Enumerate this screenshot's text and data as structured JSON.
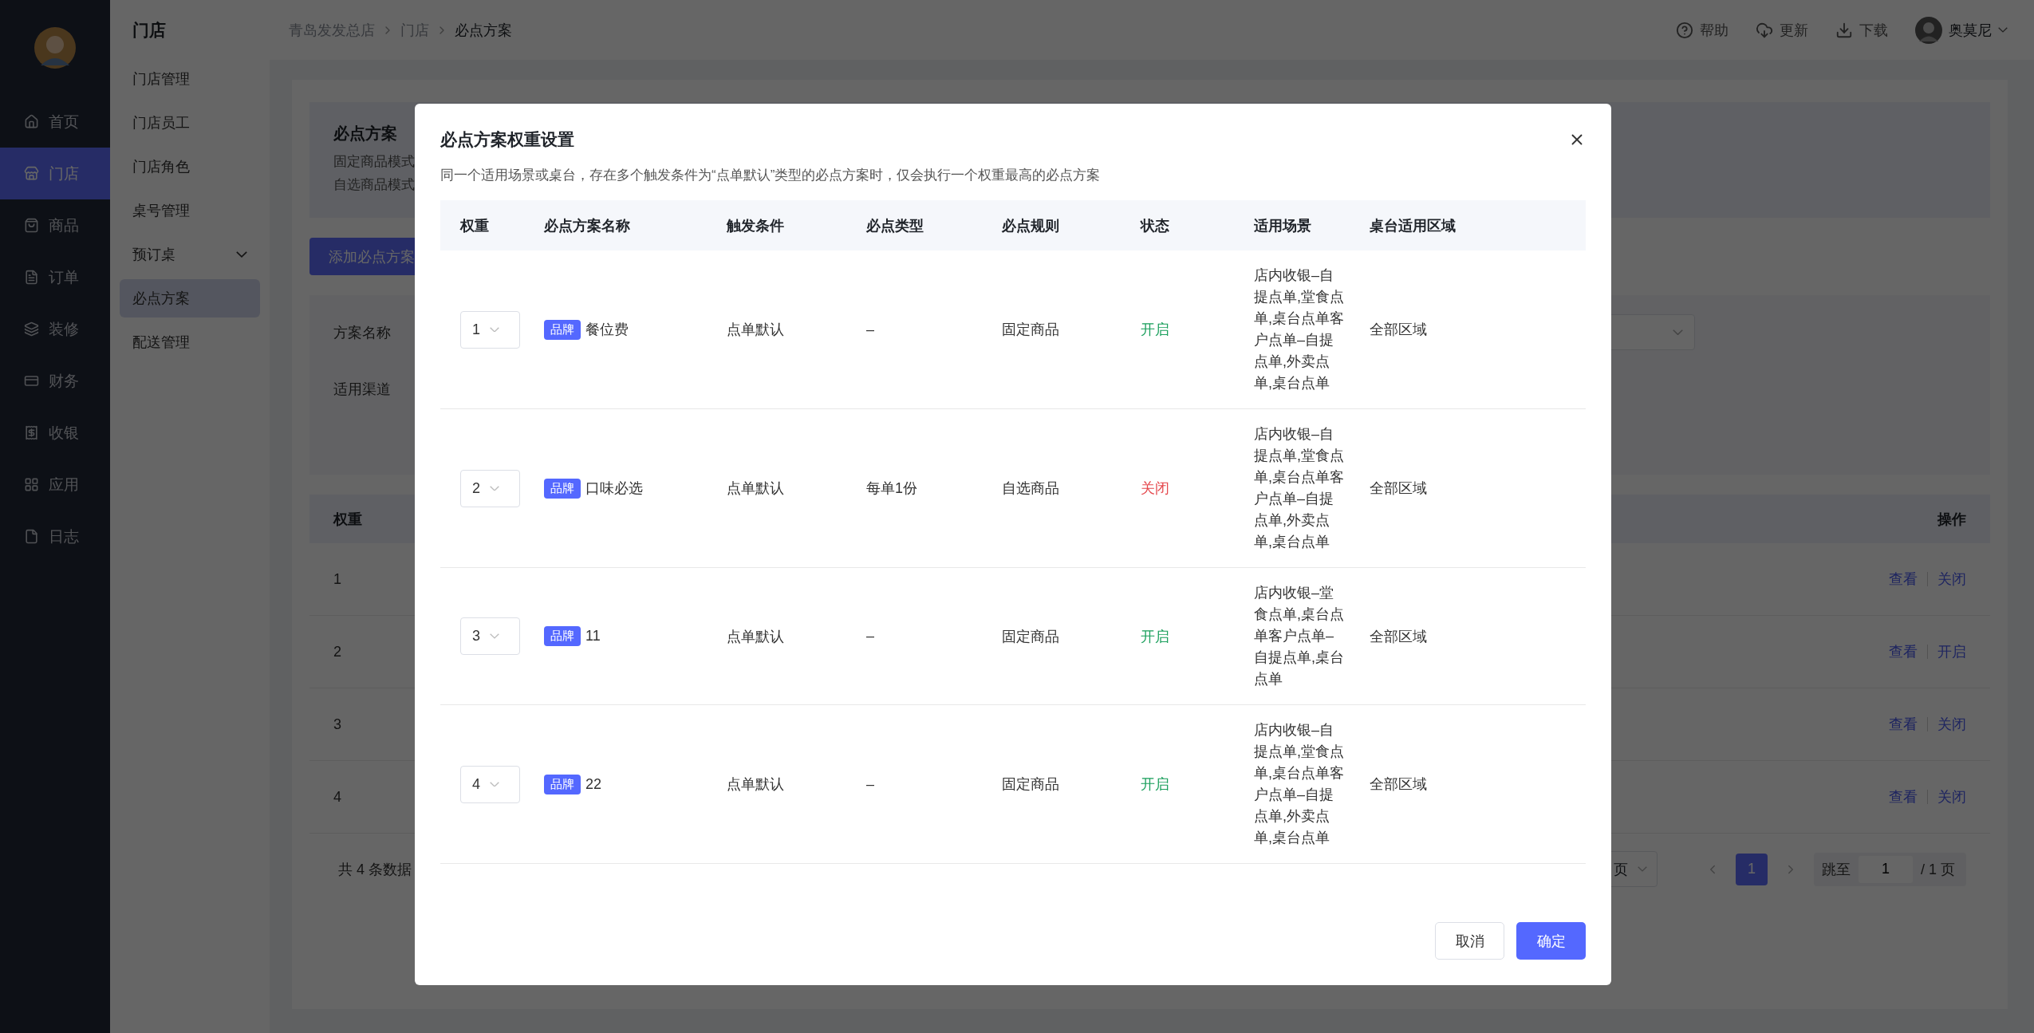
{
  "sidebar": {
    "items": [
      {
        "label": "首页",
        "selected": false
      },
      {
        "label": "门店",
        "selected": true
      },
      {
        "label": "商品",
        "selected": false
      },
      {
        "label": "订单",
        "selected": false
      },
      {
        "label": "装修",
        "selected": false
      },
      {
        "label": "财务",
        "selected": false
      },
      {
        "label": "收银",
        "selected": false
      },
      {
        "label": "应用",
        "selected": false
      },
      {
        "label": "日志",
        "selected": false
      }
    ]
  },
  "submenu": {
    "title": "门店",
    "items": [
      {
        "label": "门店管理",
        "selected": false,
        "kind": "link"
      },
      {
        "label": "门店员工",
        "selected": false,
        "kind": "link"
      },
      {
        "label": "门店角色",
        "selected": false,
        "kind": "link"
      },
      {
        "label": "桌号管理",
        "selected": false,
        "kind": "link"
      },
      {
        "label": "预订桌",
        "selected": false,
        "kind": "group"
      },
      {
        "label": "必点方案",
        "selected": true,
        "kind": "link"
      },
      {
        "label": "配送管理",
        "selected": false,
        "kind": "link"
      }
    ]
  },
  "header": {
    "breadcrumb": [
      "青岛发发总店",
      "门店",
      "必点方案"
    ],
    "actions": [
      "帮助",
      "更新",
      "下载"
    ],
    "user": "奥莫尼"
  },
  "page": {
    "intro": {
      "title": "必点方案",
      "lines": [
        "固定商品模式",
        "自选商品模式"
      ]
    },
    "add_button": "添加必点方案",
    "filters": [
      "方案名称",
      "适用渠道"
    ],
    "table": {
      "columns": [
        "权重",
        "操作"
      ],
      "rows": [
        {
          "weight": "1",
          "actions": [
            "查看",
            "关闭"
          ]
        },
        {
          "weight": "2",
          "actions": [
            "查看",
            "开启"
          ]
        },
        {
          "weight": "3",
          "actions": [
            "查看",
            "关闭"
          ]
        },
        {
          "weight": "4",
          "actions": [
            "查看",
            "关闭"
          ]
        }
      ]
    },
    "total": "共 4 条数据",
    "page_size": "页",
    "pages": [
      {
        "label": "1",
        "selected": true
      }
    ],
    "jump_label": "跳至",
    "jump_value": "1",
    "page_total": "/ 1 页"
  },
  "modal": {
    "title": "必点方案权重设置",
    "description": "同一个适用场景或桌台，存在多个触发条件为“点单默认”类型的必点方案时，仅会执行一个权重最高的必点方案",
    "columns": [
      "权重",
      "必点方案名称",
      "触发条件",
      "必点类型",
      "必点规则",
      "状态",
      "适用场景",
      "桌台适用区域"
    ],
    "rows": [
      {
        "weight": "1",
        "tag": "品牌",
        "name": "餐位费",
        "trigger": "点单默认",
        "type": "–",
        "rule": "固定商品",
        "status": {
          "label": "开启",
          "on": true
        },
        "scenes": "店内收银–自提点单,堂食点单,桌台点单客户点单–自提点单,外卖点单,桌台点单",
        "area": "全部区域"
      },
      {
        "weight": "2",
        "tag": "品牌",
        "name": "口味必选",
        "trigger": "点单默认",
        "type": "每单1份",
        "rule": "自选商品",
        "status": {
          "label": "关闭",
          "on": false
        },
        "scenes": "店内收银–自提点单,堂食点单,桌台点单客户点单–自提点单,外卖点单,桌台点单",
        "area": "全部区域"
      },
      {
        "weight": "3",
        "tag": "品牌",
        "name": "11",
        "trigger": "点单默认",
        "type": "–",
        "rule": "固定商品",
        "status": {
          "label": "开启",
          "on": true
        },
        "scenes": "店内收银–堂食点单,桌台点单客户点单–自提点单,桌台点单",
        "area": "全部区域"
      },
      {
        "weight": "4",
        "tag": "品牌",
        "name": "22",
        "trigger": "点单默认",
        "type": "–",
        "rule": "固定商品",
        "status": {
          "label": "开启",
          "on": true
        },
        "scenes": "店内收银–自提点单,堂食点单,桌台点单客户点单–自提点单,外卖点单,桌台点单",
        "area": "全部区域"
      }
    ],
    "buttons": [
      {
        "label": "取消",
        "kind": "default"
      },
      {
        "label": "确定",
        "kind": "primary"
      }
    ]
  }
}
